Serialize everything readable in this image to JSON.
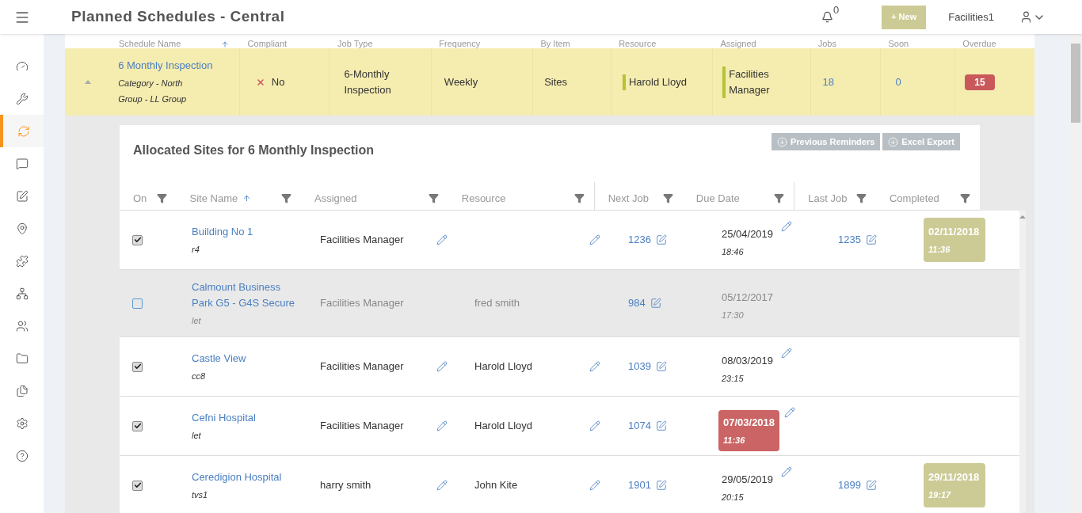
{
  "header": {
    "title": "Planned Schedules - Central",
    "notifications": "0",
    "new_button": "+ New",
    "user": "Facilities1"
  },
  "sidebar": {
    "items": [
      {
        "selected": false
      },
      {
        "selected": false
      },
      {
        "selected": true
      },
      {
        "selected": false
      },
      {
        "selected": false
      },
      {
        "selected": false
      },
      {
        "selected": false
      },
      {
        "selected": false
      },
      {
        "selected": false
      },
      {
        "selected": false
      },
      {
        "selected": false
      },
      {
        "selected": false
      },
      {
        "selected": false
      }
    ]
  },
  "schedules": {
    "columns": [
      {
        "label": "Schedule Name",
        "sorted": true
      },
      {
        "label": "Compliant",
        "sorted": false
      },
      {
        "label": "Job Type",
        "sorted": false
      },
      {
        "label": "Frequency",
        "sorted": false
      },
      {
        "label": "By Item",
        "sorted": false
      },
      {
        "label": "Resource",
        "sorted": false
      },
      {
        "label": "Assigned",
        "sorted": false
      },
      {
        "label": "Jobs",
        "sorted": false
      },
      {
        "label": "Soon",
        "sorted": false
      },
      {
        "label": "Overdue",
        "sorted": false
      }
    ],
    "rows": [
      {
        "expanded": true,
        "name": "6 Monthly Inspection",
        "category": "Category - North",
        "group": "Group - LL Group",
        "compliant": "No",
        "compliant_ok": false,
        "job_type": "6-Monthly Inspection",
        "frequency": "Weekly",
        "by_item": "Sites",
        "resource": "Harold Lloyd",
        "assigned": "Facilities Manager",
        "jobs": "18",
        "soon": "0",
        "overdue": "15"
      }
    ]
  },
  "allocated": {
    "title": "Allocated Sites for 6 Monthly Inspection",
    "buttons": [
      "Previous Reminders",
      "Excel Export"
    ],
    "columns": [
      {
        "label": "On",
        "sorted": false
      },
      {
        "label": "Site Name",
        "sorted": true
      },
      {
        "label": "Assigned",
        "sorted": false
      },
      {
        "label": "Resource",
        "sorted": false
      },
      {
        "label": "Next Job",
        "sorted": false
      },
      {
        "label": "Due Date",
        "sorted": false
      },
      {
        "label": "Last Job",
        "sorted": false
      },
      {
        "label": "Completed",
        "sorted": false
      }
    ],
    "rows": [
      {
        "on": true,
        "disabled": false,
        "site": "Building No 1",
        "code": "r4",
        "assigned": "Facilities Manager",
        "next_job": "1236",
        "due_date": "25/04/2019",
        "due_time": "18:46",
        "overdue": false,
        "last_job": "1235",
        "completed_date": "02/11/2018",
        "completed_time": "11:36"
      },
      {
        "on": false,
        "disabled": true,
        "site": "Calmount Business Park G5 - G4S Secure",
        "code": "let",
        "assigned": "Facilities Manager",
        "resource": "fred smith",
        "next_job": "984",
        "due_date": "05/12/2017",
        "due_time": "17:30",
        "overdue": false
      },
      {
        "on": true,
        "disabled": false,
        "site": "Castle View",
        "code": "cc8",
        "assigned": "Facilities Manager",
        "resource": "Harold Lloyd",
        "next_job": "1039",
        "due_date": "08/03/2019",
        "due_time": "23:15",
        "overdue": false
      },
      {
        "on": true,
        "disabled": false,
        "site": "Cefni Hospital",
        "code": "let",
        "assigned": "Facilities Manager",
        "resource": "Harold Lloyd",
        "next_job": "1074",
        "due_date": "07/03/2018",
        "due_time": "11:36",
        "overdue": true
      },
      {
        "on": true,
        "disabled": false,
        "site": "Ceredigion Hospital",
        "code": "tvs1",
        "assigned": "harry smith",
        "resource": "John Kite",
        "next_job": "1901",
        "due_date": "29/05/2019",
        "due_time": "20:15",
        "overdue": false,
        "last_job": "1899",
        "completed_date": "29/11/2018",
        "completed_time": "19:17"
      }
    ]
  }
}
